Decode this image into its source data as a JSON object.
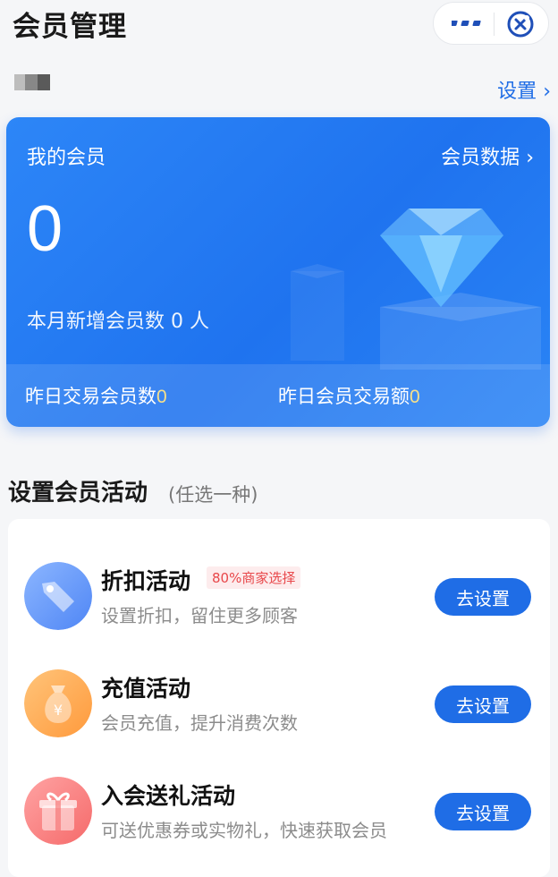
{
  "header": {
    "title": "会员管理",
    "settings_label": "设置",
    "more_icon": "more-dots-icon",
    "close_icon": "close-target-icon"
  },
  "member_card": {
    "label": "我的会员",
    "data_link": "会员数据",
    "count": "0",
    "month_new_label": "本月新增会员数",
    "month_new_value": "0",
    "month_new_unit": "人",
    "yesterday_members_label": "昨日交易会员数",
    "yesterday_members_value": "0",
    "yesterday_amount_label": "昨日会员交易额",
    "yesterday_amount_value": "0",
    "accent": "#1f73ef"
  },
  "activities_section": {
    "title": "设置会员活动",
    "subtitle": "(任选一种)",
    "items": [
      {
        "title": "折扣活动",
        "badge": "80%商家选择",
        "desc": "设置折扣，留住更多顾客",
        "button": "去设置",
        "icon": "discount-tag-icon"
      },
      {
        "title": "充值活动",
        "badge": "",
        "desc": "会员充值，提升消费次数",
        "button": "去设置",
        "icon": "money-bag-icon"
      },
      {
        "title": "入会送礼活动",
        "badge": "",
        "desc": "可送优惠券或实物礼，快速获取会员",
        "button": "去设置",
        "icon": "gift-box-icon"
      }
    ]
  },
  "colors": {
    "primary": "#1f6de6",
    "badge_text": "#e8474a",
    "badge_bg": "#fdeced",
    "highlight_number": "#f7e08a"
  }
}
